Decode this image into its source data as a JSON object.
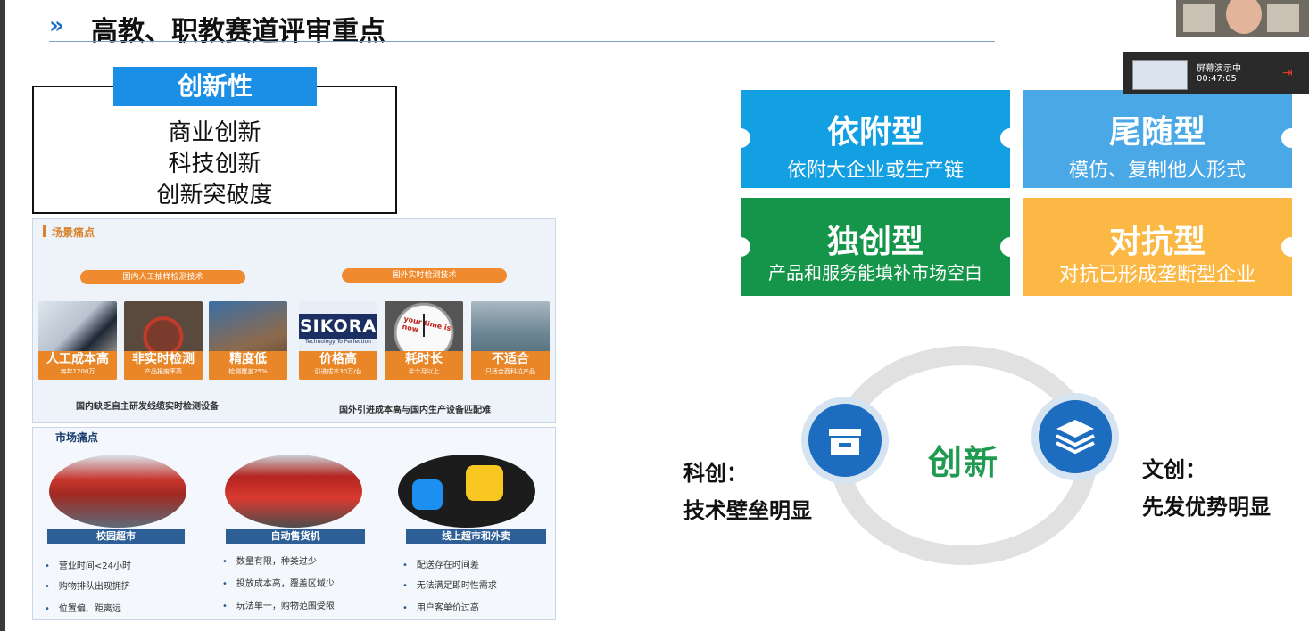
{
  "slide": {
    "title": "高教、职教赛道评审重点",
    "title_arrow": "»"
  },
  "innovation": {
    "tag": "创新性",
    "items": [
      "商业创新",
      "科技创新",
      "创新突破度"
    ]
  },
  "scene_pain": {
    "header": "场景痛点",
    "group_domestic": "国内人工抽样检测技术",
    "group_foreign": "国外实时检测技术",
    "cards": [
      {
        "title": "人工成本高",
        "sub": "每年1200万"
      },
      {
        "title": "非实时检测",
        "sub": "产品报废率高"
      },
      {
        "title": "精度低",
        "sub": "检测覆盖25%"
      },
      {
        "title": "价格高",
        "sub": "引进成本30万/台"
      },
      {
        "title": "耗时长",
        "sub": "半个月以上"
      },
      {
        "title": "不适合",
        "sub": "只适合西科拉产品"
      }
    ],
    "sikora_logo": "SIKORA",
    "sikora_tagline": "Technology To Perfection",
    "clock_text": "your time is now",
    "footer_left": "国内缺乏自主研发线缆实时检测设备",
    "footer_right": "国外引进成本高与国内生产设备匹配难"
  },
  "market_pain": {
    "header": "市场痛点",
    "columns": [
      {
        "tag": "校园超市",
        "bullets": [
          "营业时间<24小时",
          "购物排队出现拥挤",
          "位置偏、距离远"
        ]
      },
      {
        "tag": "自动售货机",
        "bullets": [
          "数量有限，种类过少",
          "投放成本高，覆盖区域少",
          "玩法单一，购物范围受限"
        ]
      },
      {
        "tag": "线上超市和外卖",
        "bullets": [
          "配送存在时间差",
          "无法满足即时性需求",
          "用户客单价过高"
        ]
      }
    ]
  },
  "tiles": [
    {
      "heading": "依附型",
      "desc": "依附大企业或生产链",
      "color": "#13a0e3"
    },
    {
      "heading": "尾随型",
      "desc": "模仿、复制他人形式",
      "color": "#4aa8e6"
    },
    {
      "heading": "独创型",
      "desc": "产品和服务能填补市场空白",
      "color": "#14954a"
    },
    {
      "heading": "对抗型",
      "desc": "对抗已形成垄断型企业",
      "color": "#fbb845"
    }
  ],
  "diagram": {
    "center": "创新",
    "left_label": "科创：",
    "left_desc": "技术壁垒明显",
    "right_label": "文创：",
    "right_desc": "先发优势明显",
    "left_icon": "store-icon",
    "right_icon": "layers-icon"
  },
  "overlay": {
    "status": "屏幕演示中",
    "timer": "00:47:05"
  }
}
